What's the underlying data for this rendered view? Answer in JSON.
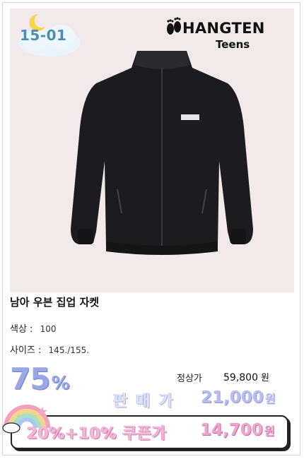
{
  "badge": {
    "code": "15-01"
  },
  "brand": {
    "name": "HANGTEN",
    "sub": "Teens"
  },
  "product": {
    "title": "남아 우븐 집업 자켓",
    "color_label": "색상 :",
    "color_value": "100",
    "size_label": "사이즈 :",
    "size_value": "145./155."
  },
  "pricing": {
    "discount_value": "75",
    "discount_unit": "%",
    "regular_label": "정상가",
    "regular_price": "59,800",
    "regular_unit": "원",
    "sale_label": "판매가",
    "sale_price": "21,000",
    "sale_unit": "원",
    "coupon_label": "20%+10% 쿠폰가",
    "coupon_price": "14,700",
    "coupon_unit": "원"
  },
  "colors": {
    "image_bg": "#f2e9ea",
    "badge_text": "#4a8fb2",
    "discount": "#9aa8e6",
    "coupon": "#f0a5cf"
  }
}
